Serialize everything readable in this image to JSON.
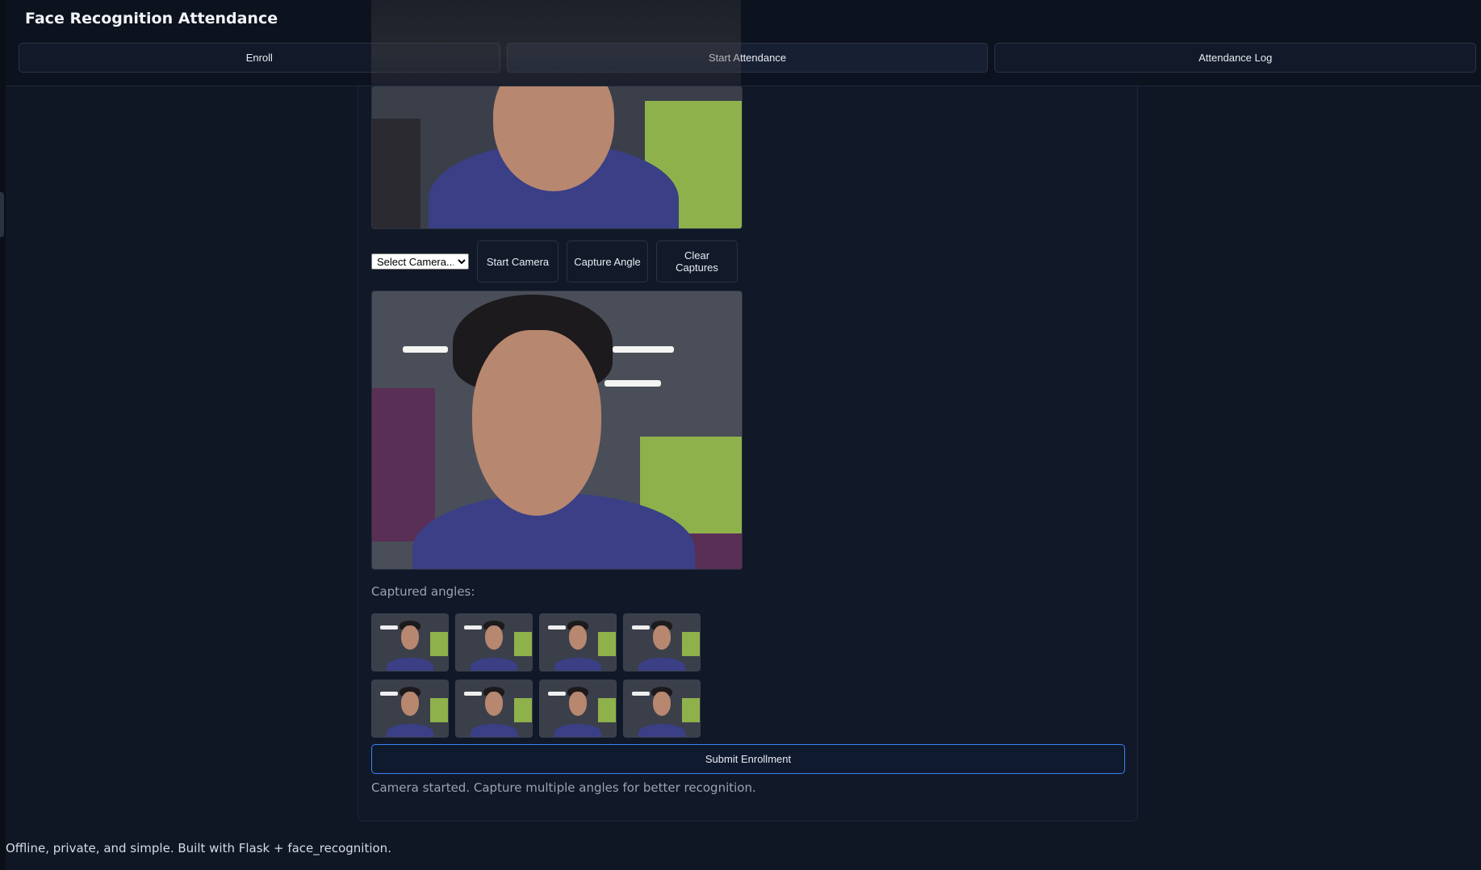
{
  "app": {
    "title": "Face Recognition Attendance"
  },
  "tabs": [
    {
      "label": "Enroll"
    },
    {
      "label": "Start Attendance"
    },
    {
      "label": "Attendance Log"
    }
  ],
  "controls": {
    "camera_select_value": "Select Camera...",
    "start_camera": "Start Camera",
    "capture_angle": "Capture Angle",
    "clear_captures": "Clear Captures"
  },
  "captured": {
    "label": "Captured angles:",
    "thumbnails": [
      "angle-1",
      "angle-2",
      "angle-3",
      "angle-4",
      "angle-5",
      "angle-6",
      "angle-7",
      "angle-8"
    ]
  },
  "submit": {
    "label": "Submit Enrollment"
  },
  "status": {
    "message": "Camera started. Capture multiple angles for better recognition."
  },
  "footer": {
    "text": "Offline, private, and simple. Built with Flask + face_recognition."
  },
  "colors": {
    "background": "#0f1624",
    "card": "#111827",
    "accent_border": "#3b82f6"
  }
}
